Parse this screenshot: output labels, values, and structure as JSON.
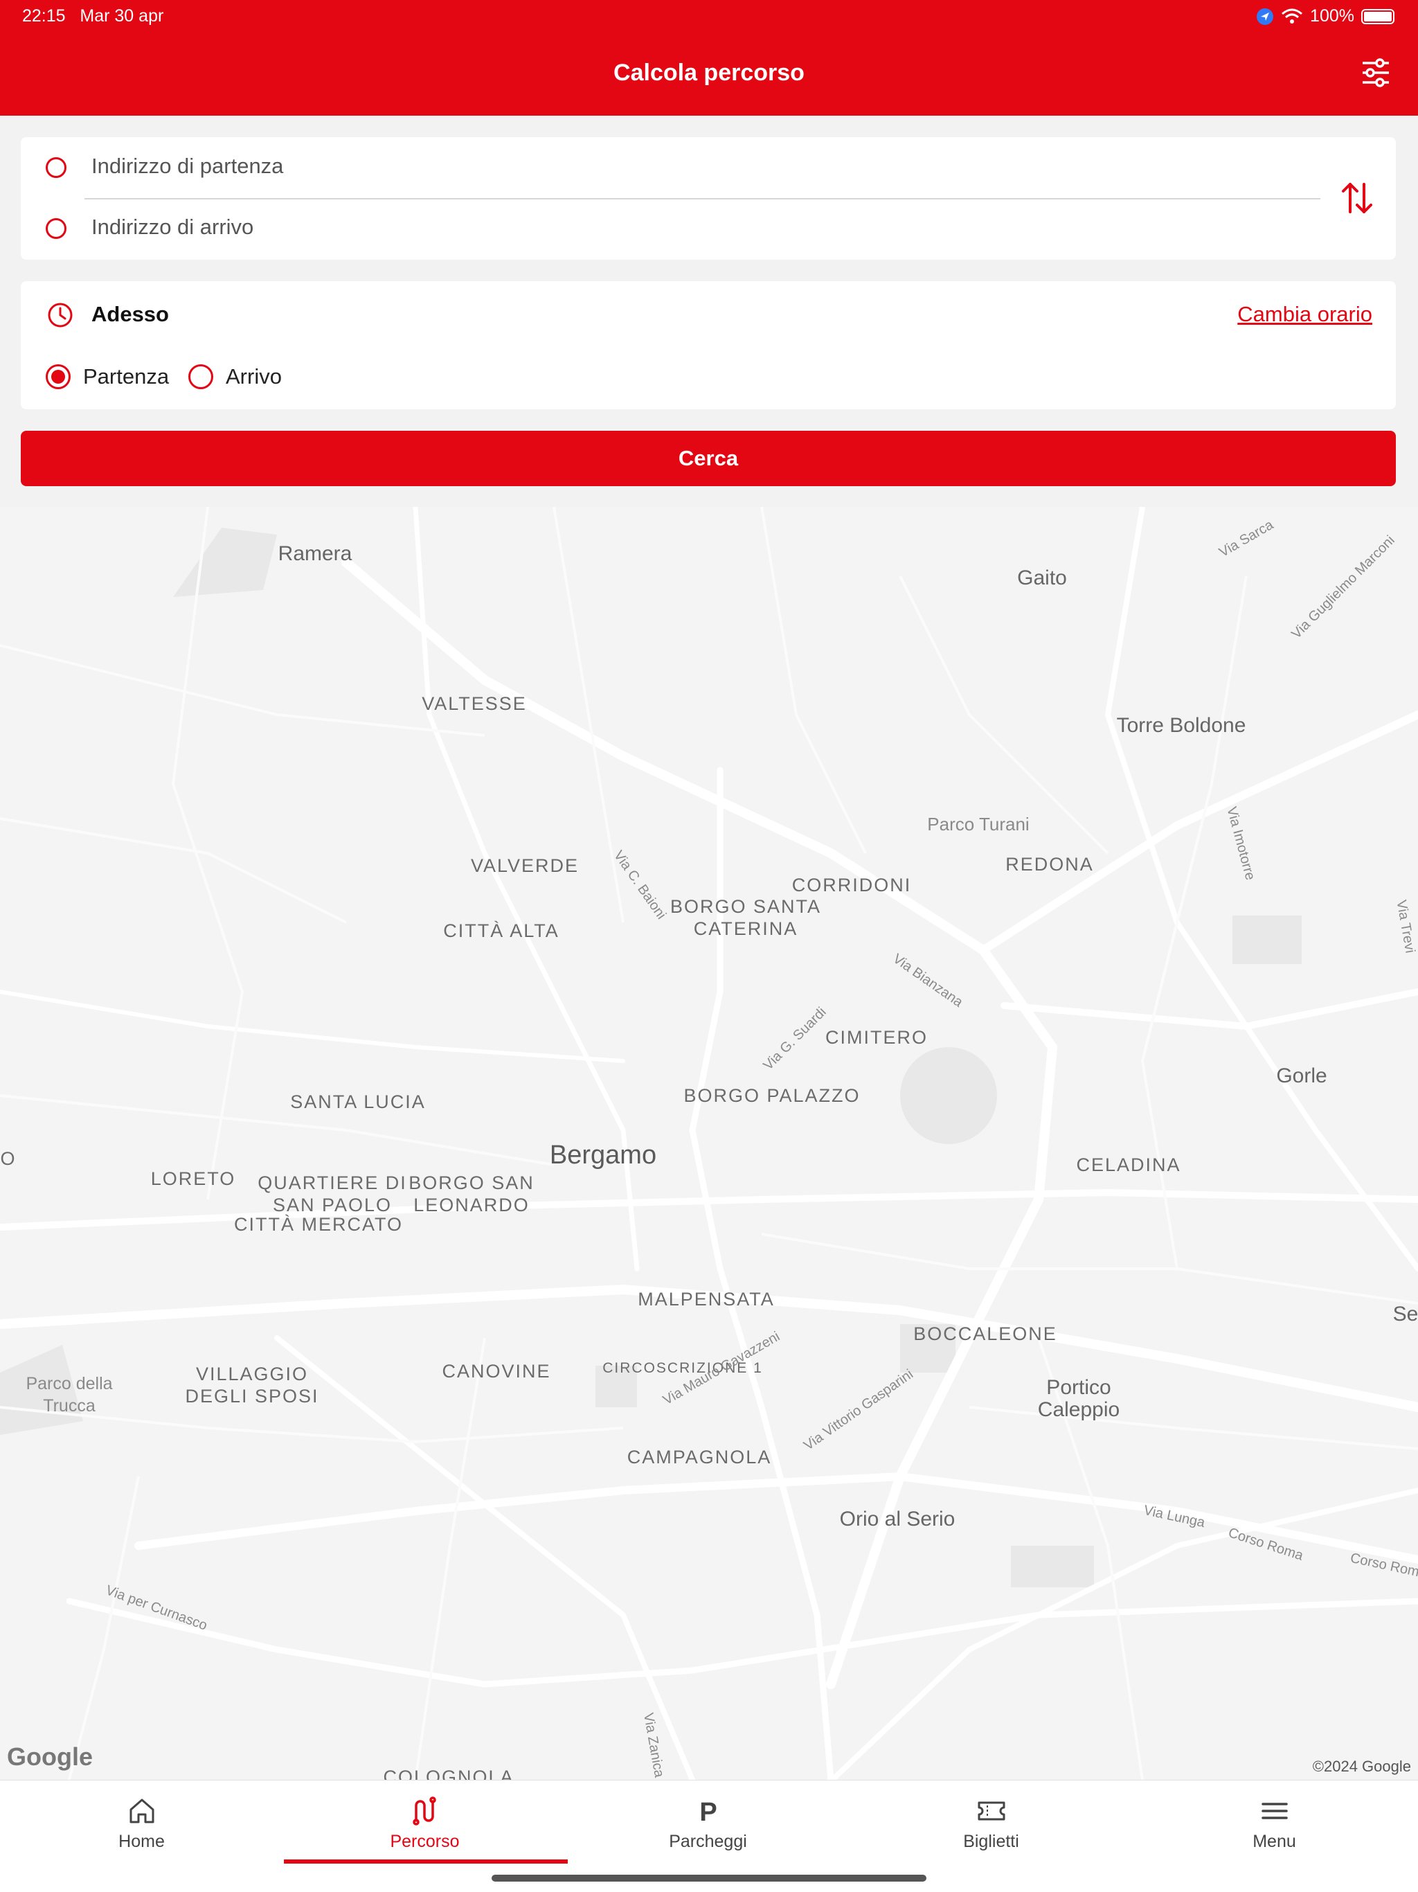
{
  "status_bar": {
    "time": "22:15",
    "date": "Mar 30 apr",
    "battery": "100%"
  },
  "header": {
    "title": "Calcola percorso",
    "filter_icon": "sliders-icon",
    "background": "#e30613"
  },
  "route_form": {
    "departure_placeholder": "Indirizzo di partenza",
    "arrival_placeholder": "Indirizzo di arrivo",
    "swap_icon": "swap-vertical-icon"
  },
  "time_options": {
    "time_label": "Adesso",
    "change_time_link": "Cambia orario",
    "mode_departure": "Partenza",
    "mode_arrival": "Arrivo",
    "selected_mode": "Partenza"
  },
  "search_button": "Cerca",
  "map": {
    "city": "Bergamo",
    "labels": {
      "ramera": "Ramera",
      "gaito": "Gaito",
      "valtesse": "VALTESSE",
      "torre_boldone": "Torre Boldone",
      "parco_turani": "Parco Turani",
      "redona": "REDONA",
      "valverde": "VALVERDE",
      "corridoni": "CORRIDONI",
      "borgo_santa_caterina_1": "BORGO SANTA",
      "borgo_santa_caterina_2": "CATERINA",
      "citta_alta": "CITTÀ ALTA",
      "cimitero": "CIMITERO",
      "gorle": "Gorle",
      "santa_lucia": "SANTA LUCIA",
      "borgo_palazzo": "BORGO PALAZZO",
      "celadina": "CELADINA",
      "loreto": "LORETO",
      "quartiere_1": "QUARTIERE DI",
      "quartiere_2": "SAN PAOLO",
      "borgo_san_1": "BORGO SAN",
      "borgo_san_2": "LEONARDO",
      "citta_mercato": "CITTÀ MERCATO",
      "malpensata": "MALPENSATA",
      "boccaleone": "BOCCALEONE",
      "villaggio_1": "VILLAGGIO",
      "villaggio_2": "DEGLI SPOSI",
      "canovine": "CANOVINE",
      "circoscrizione": "CIRCOSCRIZIONE 1",
      "portico_1": "Portico",
      "portico_2": "Caleppio",
      "parco_trucca_1": "Parco della",
      "parco_trucca_2": "Trucca",
      "campagnola": "CAMPAGNOLA",
      "orio": "Orio al Serio",
      "colognola": "COLOGNOLA",
      "se": "Se",
      "o_edge": "O"
    },
    "streets": {
      "via_sarca": "Via Sarca",
      "via_marconi": "Via Guglielmo Marconi",
      "via_imotorre": "Via Imotorre",
      "via_baioni": "Via C. Baioni",
      "via_bianzana": "Via Bianzana",
      "via_suardi": "Via G. Suardi",
      "via_gavazzeni": "Via Mauro Gavazzeni",
      "via_gasparini": "Via Vittorio Gasparini",
      "via_lunga": "Via Lunga",
      "corso_roma": "Corso Roma",
      "corso_roma_2": "Corso Rom",
      "via_curnasco": "Via per Curnasco",
      "via_zanica": "Via Zanica",
      "via_treviglio": "Via Trevi"
    },
    "attribution_logo": "Google",
    "copyright": "©2024 Google"
  },
  "tabbar": {
    "items": [
      {
        "label": "Home",
        "icon": "home-icon"
      },
      {
        "label": "Percorso",
        "icon": "route-icon"
      },
      {
        "label": "Parcheggi",
        "icon": "parking-icon"
      },
      {
        "label": "Biglietti",
        "icon": "ticket-icon"
      },
      {
        "label": "Menu",
        "icon": "menu-icon"
      }
    ],
    "active": "Percorso",
    "accent": "#e30613"
  }
}
